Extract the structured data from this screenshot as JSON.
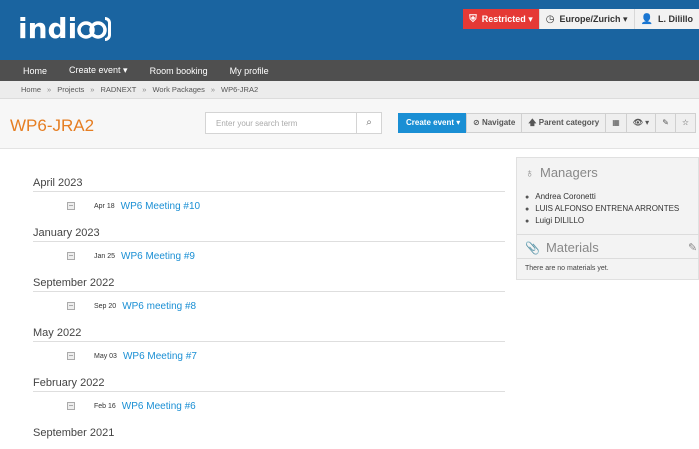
{
  "header": {
    "logo_prefix": "indi",
    "status": {
      "restricted": "Restricted ▾",
      "timezone": "Europe/Zurich ▾",
      "user": "L. Dilillo"
    }
  },
  "nav": {
    "items": [
      "Home",
      "Create event ▾",
      "Room booking",
      "My profile"
    ]
  },
  "breadcrumb": [
    "Home",
    "Projects",
    "RADNEXT",
    "Work Packages",
    "WP6-JRA2"
  ],
  "page": {
    "title": "WP6-JRA2",
    "search_placeholder": "Enter your search term",
    "create_event": "Create event ▾",
    "toolbar": {
      "navigate": "Navigate",
      "parent_category": "Parent category"
    }
  },
  "events": [
    {
      "month": "April 2023",
      "date": "Apr 18",
      "title": "WP6 Meeting #10"
    },
    {
      "month": "January 2023",
      "date": "Jan 25",
      "title": "WP6 Meeting #9"
    },
    {
      "month": "September 2022",
      "date": "Sep 20",
      "title": "WP6 meeting #8"
    },
    {
      "month": "May 2022",
      "date": "May 03",
      "title": "WP6 Meeting #7"
    },
    {
      "month": "February 2022",
      "date": "Feb 16",
      "title": "WP6 Meeting #6"
    },
    {
      "month": "September 2021"
    }
  ],
  "sidebar": {
    "managers_title": "Managers",
    "managers": [
      "Andrea Coronetti",
      "LUIS ALFONSO ENTRENA ARRONTES",
      "Luigi DILILLO"
    ],
    "materials_title": "Materials",
    "materials_empty": "There are no materials yet."
  },
  "colors": {
    "header": "#1a64a0",
    "nav": "#4f4f4f",
    "accent": "#1a8fd4",
    "title": "#e67e22",
    "restricted": "#e53935"
  }
}
